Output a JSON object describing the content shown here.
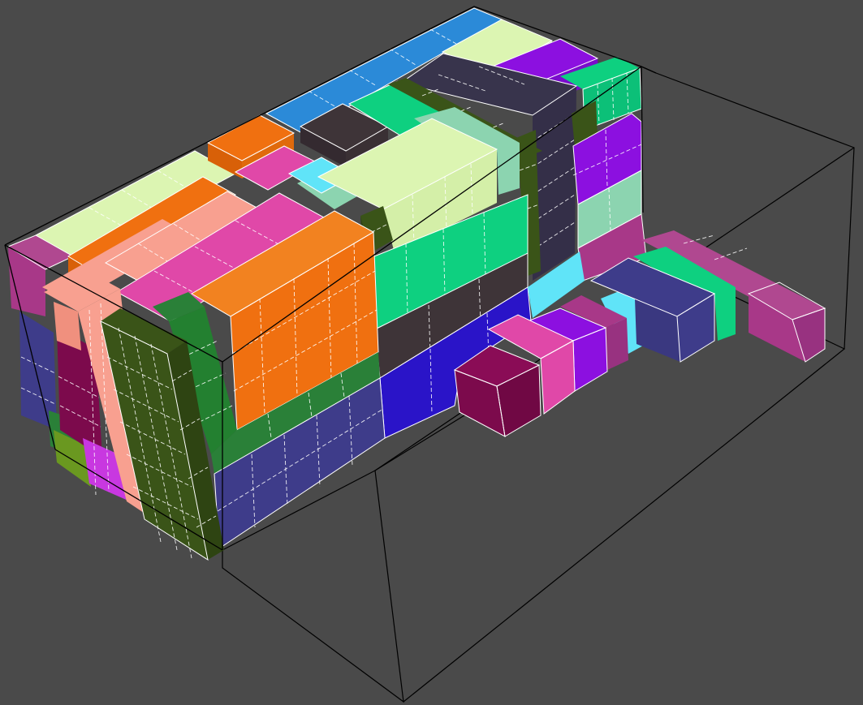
{
  "scene": {
    "background": "#4a4a4a",
    "container_frame_color": "#000000",
    "grid_color": "#ffffff",
    "box_colors": {
      "light_green": "#dcf5b2",
      "blue": "#2b8ad8",
      "orange": "#f07010",
      "pink": "#e048a8",
      "salmon": "#f8a090",
      "dark_olive": "#3a5418",
      "forest_green": "#2a8038",
      "navy": "#3e3c8a",
      "royal_blue": "#2a14c8",
      "dark_brown": "#3e3438",
      "slate": "#38344c",
      "mint": "#0ed080",
      "pale_mint": "#8cd4b0",
      "cyan": "#60e4f8",
      "violet": "#8c10e0",
      "magenta": "#c838e0",
      "plum": "#a83888",
      "maroon": "#7c0a4c",
      "olive": "#6a9820"
    }
  }
}
